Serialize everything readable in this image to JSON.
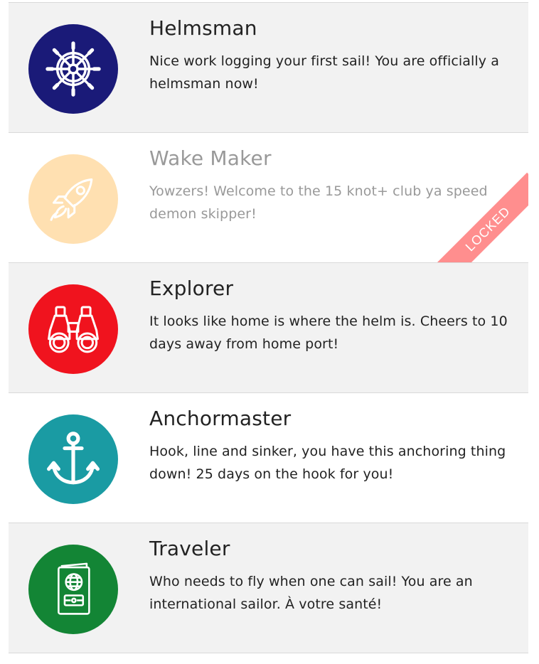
{
  "achievements": [
    {
      "title": "Helmsman",
      "description": "Nice work logging your first sail! You are officially a helmsman now!",
      "icon": "ship-wheel-icon",
      "color": "#1a1a78",
      "locked": false
    },
    {
      "title": "Wake Maker",
      "description": "Yowzers! Welcome to the 15 knot+ club ya speed demon skipper!",
      "icon": "rocket-icon",
      "color": "#ffc872",
      "locked": true,
      "locked_label": "LOCKED",
      "ribbon_color": "#ff8e8e"
    },
    {
      "title": "Explorer",
      "description": "It looks like home is where the helm is. Cheers to 10 days away from home port!",
      "icon": "binoculars-icon",
      "color": "#f0131e",
      "locked": false
    },
    {
      "title": "Anchormaster",
      "description": "Hook, line and sinker, you have this anchoring thing down! 25 days on the hook for you!",
      "icon": "anchor-icon",
      "color": "#1a9ba3",
      "locked": false
    },
    {
      "title": "Traveler",
      "description": "Who needs to fly when one can sail! You are an international sailor. À votre santé!",
      "icon": "passport-icon",
      "color": "#138535",
      "locked": false
    }
  ]
}
